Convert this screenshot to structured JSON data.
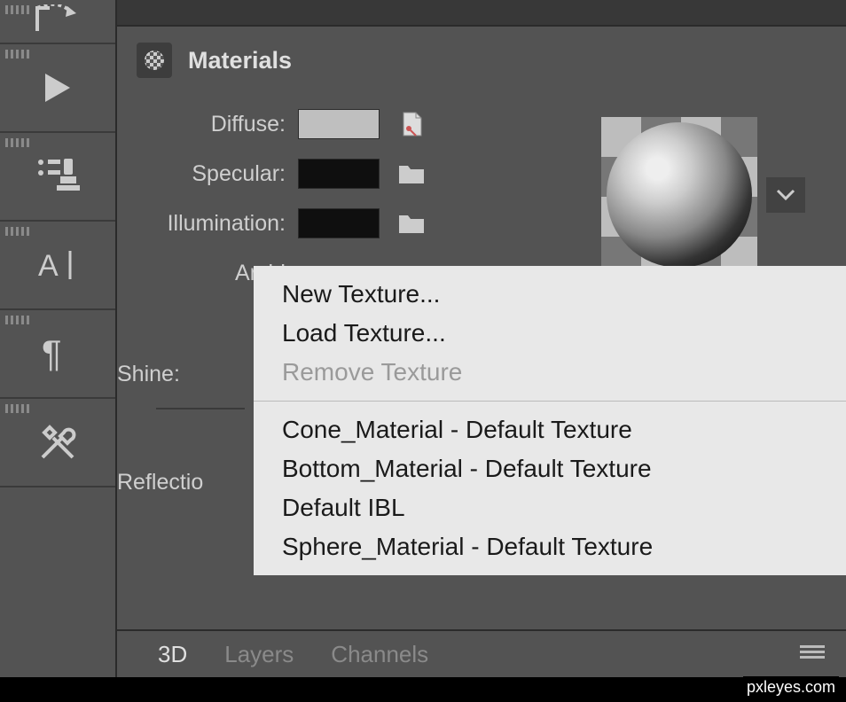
{
  "section": {
    "title": "Materials"
  },
  "props": {
    "diffuse": "Diffuse:",
    "specular": "Specular:",
    "illumination": "Illumination:",
    "ambient": "Ambi",
    "shine": "Shine:",
    "reflection": "Reflectio"
  },
  "menu": {
    "new": "New Texture...",
    "load": "Load Texture...",
    "remove": "Remove Texture",
    "items": [
      "Cone_Material - Default Texture",
      "Bottom_Material - Default Texture",
      "Default IBL",
      "Sphere_Material - Default Texture"
    ]
  },
  "tabs": {
    "t3d": "3D",
    "layers": "Layers",
    "channels": "Channels"
  },
  "watermark": "pxleyes.com"
}
